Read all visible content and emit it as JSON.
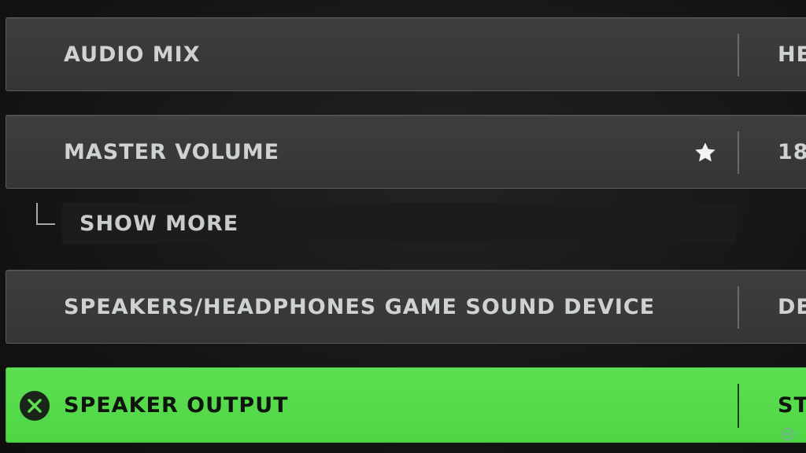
{
  "settings": {
    "rows": [
      {
        "label": "AUDIO MIX",
        "value": "HE"
      },
      {
        "label": "MASTER VOLUME",
        "value": "18",
        "favorite_icon": "star-icon"
      },
      {
        "label": "SPEAKERS/HEADPHONES GAME SOUND DEVICE",
        "value": "DE"
      },
      {
        "label": "SPEAKER OUTPUT",
        "value": "ST",
        "action_icon": "close-icon"
      }
    ],
    "show_more_label": "SHOW MORE"
  },
  "colors": {
    "row_bg": "#3a3a3a",
    "selected_bg": "#57da4c",
    "label_text": "#cfd3cf",
    "selected_text": "#0f140f"
  }
}
